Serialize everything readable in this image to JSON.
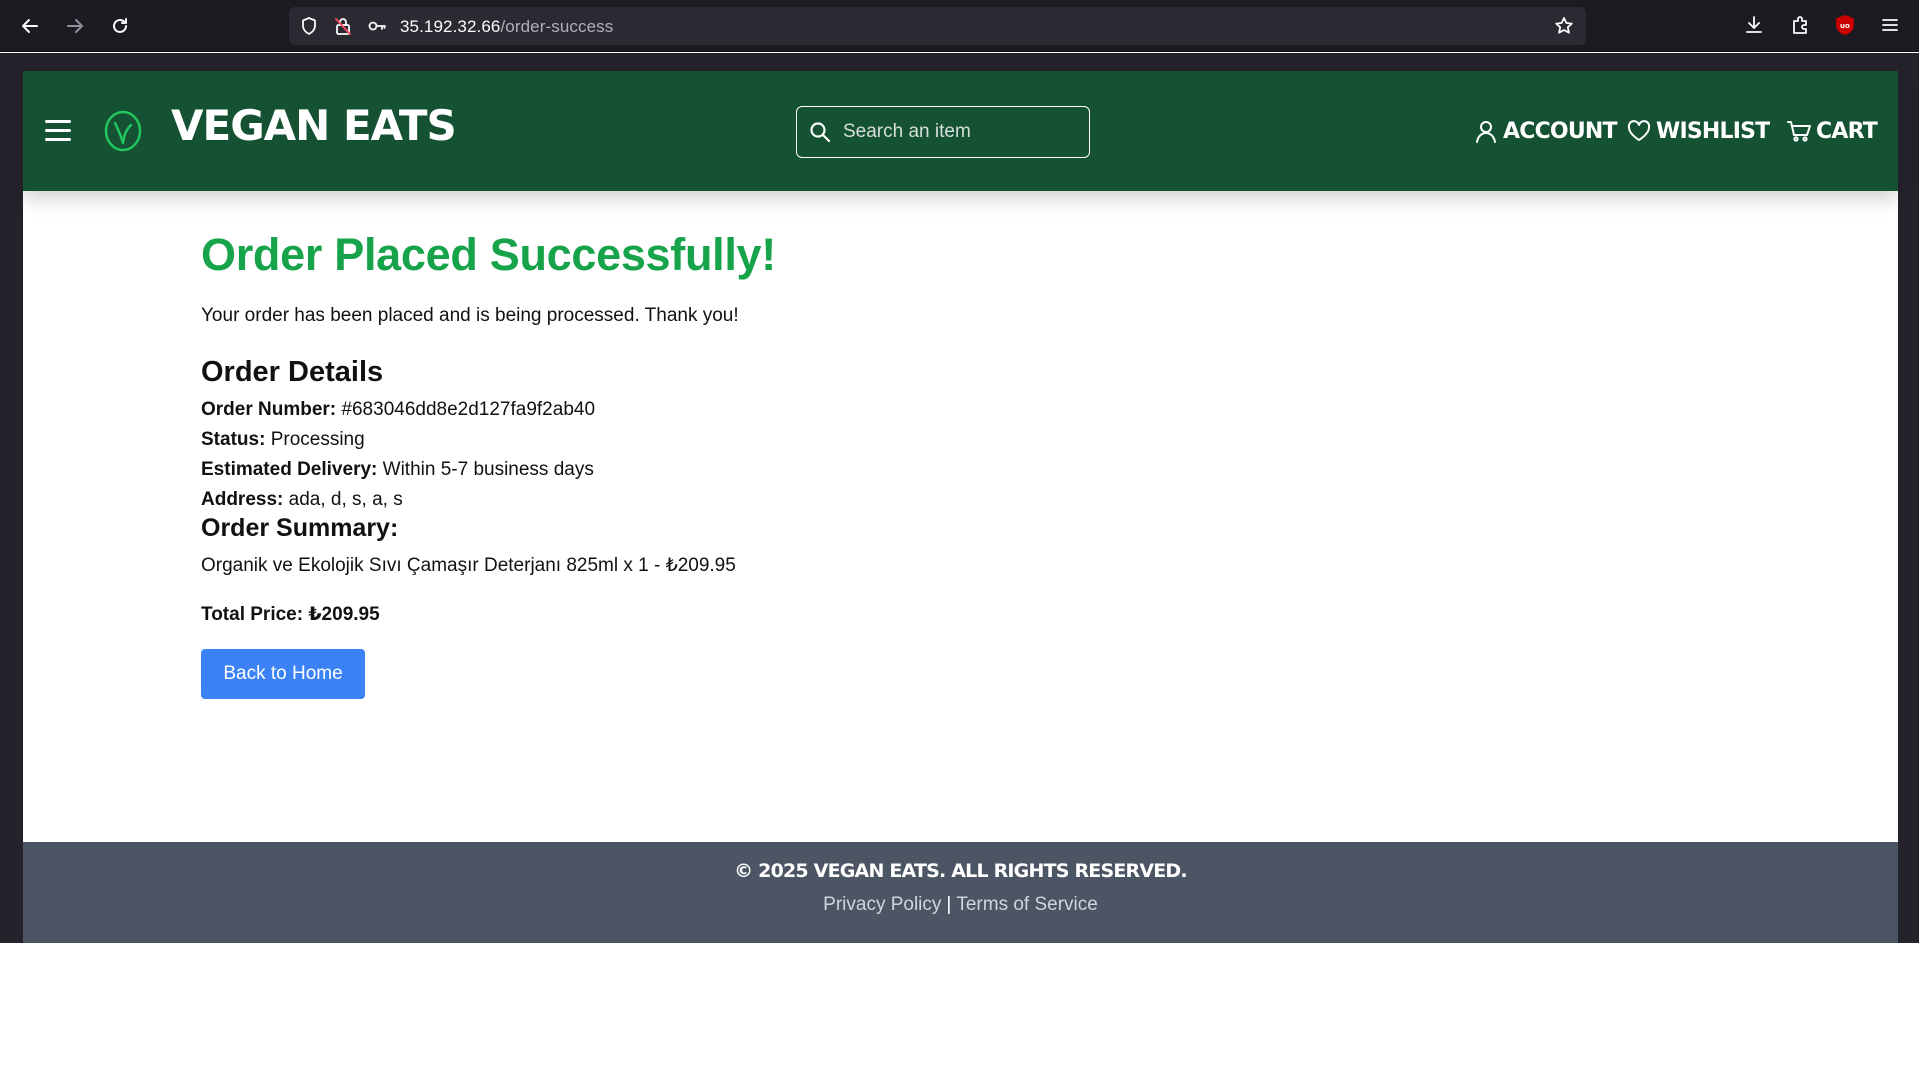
{
  "browser": {
    "url_host": "35.192.32.66",
    "url_path": "/order-success"
  },
  "header": {
    "brand": "Vegan Eats",
    "search_placeholder": "Search an item",
    "nav": {
      "account": "Account",
      "wishlist": "Wishlist",
      "cart": "Cart"
    }
  },
  "main": {
    "title": "Order Placed Successfully!",
    "intro": "Your order has been placed and is being processed. Thank you!",
    "details_heading": "Order Details",
    "details": [
      {
        "label": "Order Number:",
        "value": "#683046dd8e2d127fa9f2ab40"
      },
      {
        "label": "Status:",
        "value": "Processing"
      },
      {
        "label": "Estimated Delivery:",
        "value": "Within 5-7 business days"
      },
      {
        "label": "Address:",
        "value": "ada, d, s, a, s"
      }
    ],
    "summary_heading": "Order Summary:",
    "summary_items": [
      "Organik ve Ekolojik Sıvı Çamaşır Deterjanı 825ml x 1 - ₺209.95"
    ],
    "total_label": "Total Price: ₺209.95",
    "back_button": "Back to Home"
  },
  "footer": {
    "copyright": "© 2025 Vegan Eats. All rights reserved.",
    "privacy": "Privacy Policy",
    "separator": "|",
    "terms": "Terms of Service"
  },
  "colors": {
    "header_bg": "#155233",
    "title_green": "#16a34a",
    "button_blue": "#3b82f6",
    "footer_bg": "#4b5563"
  }
}
